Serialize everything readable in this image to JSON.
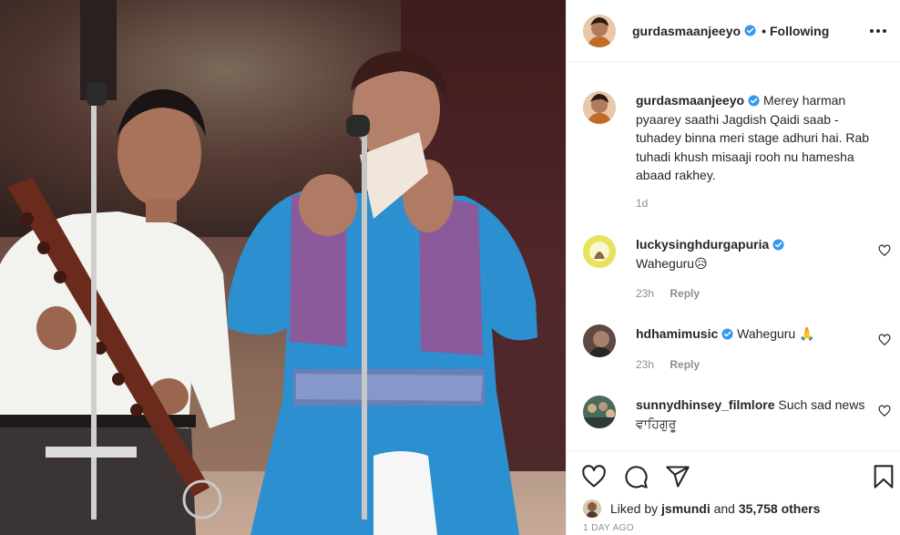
{
  "post": {
    "author": {
      "username": "gurdasmaanjeeyo",
      "verified": true,
      "follow_state": "Following"
    },
    "caption": {
      "username": "gurdasmaanjeeyo",
      "text": "Merey harman pyaarey saathi Jagdish Qaidi saab - tuhadey binna meri stage adhuri hai. Rab tuhadi khush misaaji rooh nu hamesha abaad rakhey.",
      "age": "1d"
    },
    "comments": [
      {
        "username": "luckysinghdurgapuria",
        "verified": true,
        "text": "Waheguru😥",
        "age": "23h",
        "reply_label": "Reply"
      },
      {
        "username": "hdhamimusic",
        "verified": true,
        "text": "Waheguru 🙏",
        "age": "23h",
        "reply_label": "Reply"
      },
      {
        "username": "sunnydhinsey_filmlore",
        "verified": false,
        "text": "Such sad news ਵਾਹਿਗੁਰੂ",
        "age": "",
        "reply_label": ""
      }
    ],
    "likes": {
      "prefix": "Liked by ",
      "first_liker": "jsmundi",
      "middle": " and ",
      "others": "35,758 others"
    },
    "timestamp": "1 DAY AGO",
    "icons": {
      "more": "more-options-icon",
      "like": "heart-icon",
      "comment": "comment-bubble-icon",
      "share": "paper-plane-icon",
      "save": "bookmark-icon",
      "verified": "verified-badge-icon"
    },
    "colors": {
      "verified_blue": "#3897f0",
      "text": "#262626",
      "muted": "#8e8e8e",
      "border": "#efefef"
    }
  }
}
